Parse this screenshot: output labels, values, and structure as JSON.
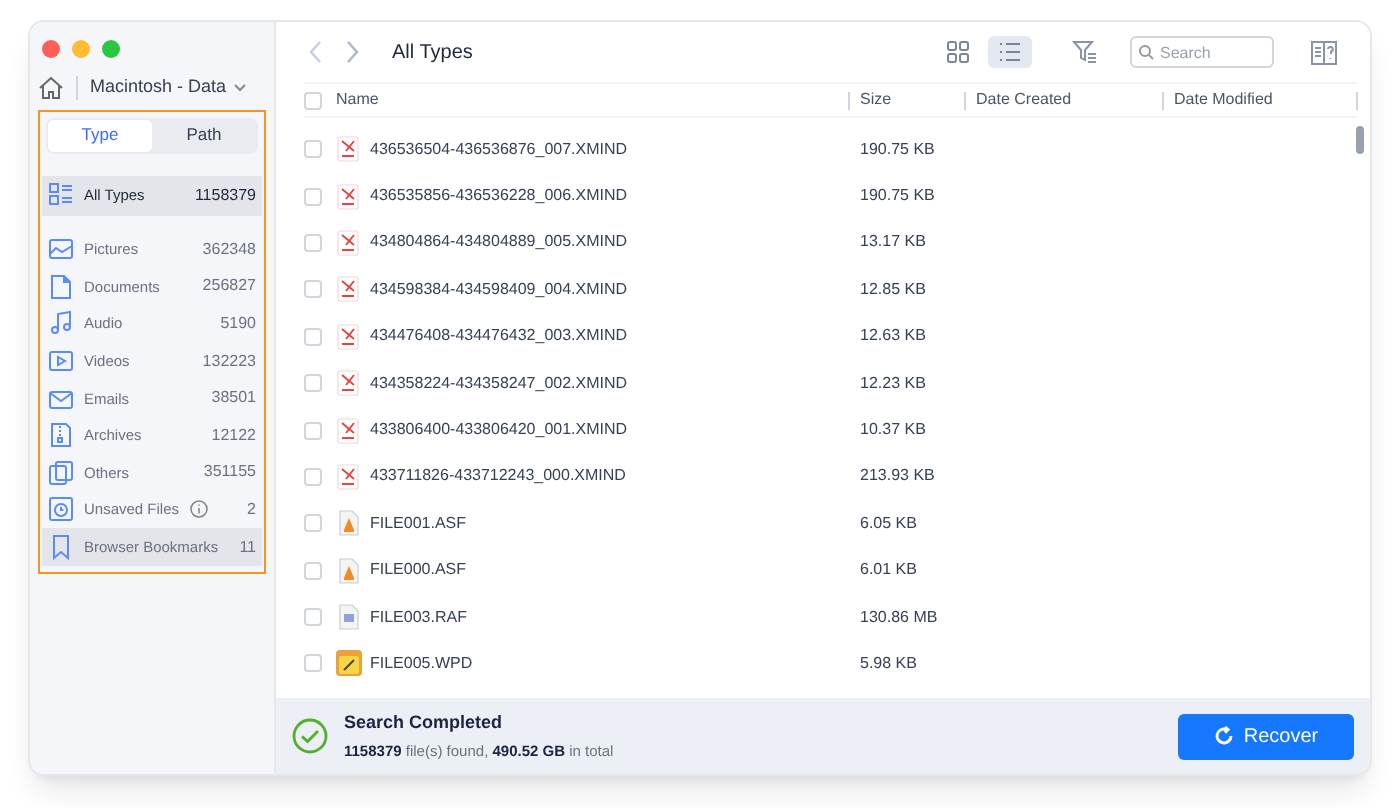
{
  "sidebar": {
    "drive": "Macintosh - Data",
    "tabs": [
      {
        "label": "Type",
        "selected": true
      },
      {
        "label": "Path",
        "selected": false
      }
    ],
    "categories": [
      {
        "kind": "all",
        "label": "All Types",
        "count": "1158379",
        "selected": true,
        "hovered": true
      },
      {
        "kind": "pictures",
        "label": "Pictures",
        "count": "362348",
        "selected": false,
        "hovered": false
      },
      {
        "kind": "documents",
        "label": "Documents",
        "count": "256827",
        "selected": false,
        "hovered": false
      },
      {
        "kind": "audio",
        "label": "Audio",
        "count": "5190",
        "selected": false,
        "hovered": false
      },
      {
        "kind": "videos",
        "label": "Videos",
        "count": "132223",
        "selected": false,
        "hovered": false
      },
      {
        "kind": "emails",
        "label": "Emails",
        "count": "38501",
        "selected": false,
        "hovered": false
      },
      {
        "kind": "archives",
        "label": "Archives",
        "count": "12122",
        "selected": false,
        "hovered": false
      },
      {
        "kind": "others",
        "label": "Others",
        "count": "351155",
        "selected": false,
        "hovered": false
      },
      {
        "kind": "unsaved",
        "label": "Unsaved Files",
        "count": "2",
        "selected": false,
        "hovered": false,
        "info": true
      },
      {
        "kind": "bookmarks",
        "label": "Browser Bookmarks",
        "count": "11",
        "selected": false,
        "hovered": true
      }
    ]
  },
  "toolbar": {
    "title": "All Types",
    "views": [
      {
        "kind": "grid",
        "selected": false
      },
      {
        "kind": "list",
        "selected": true
      }
    ],
    "search": {
      "placeholder": "Search"
    }
  },
  "table": {
    "select_all": {
      "checked": false
    },
    "columns": [
      "Name",
      "Size",
      "Date Created",
      "Date Modified"
    ],
    "rows": [
      {
        "kind": "xmind",
        "name": "436536504-436536876_007.XMIND",
        "size": "190.75 KB",
        "checked": false
      },
      {
        "kind": "xmind",
        "name": "436535856-436536228_006.XMIND",
        "size": "190.75 KB",
        "checked": false
      },
      {
        "kind": "xmind",
        "name": "434804864-434804889_005.XMIND",
        "size": "13.17 KB",
        "checked": false
      },
      {
        "kind": "xmind",
        "name": "434598384-434598409_004.XMIND",
        "size": "12.85 KB",
        "checked": false
      },
      {
        "kind": "xmind",
        "name": "434476408-434476432_003.XMIND",
        "size": "12.63 KB",
        "checked": false
      },
      {
        "kind": "xmind",
        "name": "434358224-434358247_002.XMIND",
        "size": "12.23 KB",
        "checked": false
      },
      {
        "kind": "xmind",
        "name": "433806400-433806420_001.XMIND",
        "size": "10.37 KB",
        "checked": false
      },
      {
        "kind": "xmind",
        "name": "433711826-433712243_000.XMIND",
        "size": "213.93 KB",
        "checked": false
      },
      {
        "kind": "asf",
        "name": "FILE001.ASF",
        "size": "6.05 KB",
        "checked": false
      },
      {
        "kind": "asf",
        "name": "FILE000.ASF",
        "size": "6.01 KB",
        "checked": false
      },
      {
        "kind": "raf",
        "name": "FILE003.RAF",
        "size": "130.86 MB",
        "checked": false
      },
      {
        "kind": "wpd",
        "name": "FILE005.WPD",
        "size": "5.98 KB",
        "checked": false
      }
    ]
  },
  "status_bar": {
    "title": "Search Completed",
    "summary": "**1158379** file(s) found, **490.52 GB** in total",
    "button": "Recover"
  }
}
